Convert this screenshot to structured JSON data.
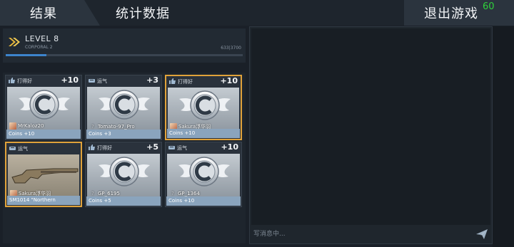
{
  "top_bar": {
    "tabs": [
      {
        "label": "结果",
        "active": true
      },
      {
        "label": "统计数据",
        "active": false
      }
    ],
    "exit_label": "退出游戏",
    "timer": "60"
  },
  "level": {
    "title": "LEVEL 8",
    "rank": "CORPORAL 2",
    "xp_text": "633|3700",
    "progress_fraction": 0.171
  },
  "rewards": [
    {
      "type_icon": "thumbs-up-icon",
      "type_label": "打得好",
      "amount": "+10",
      "player": "MrKaloz20",
      "avatar": "avatar-icon",
      "reward": "Coins +10",
      "highlight": false
    },
    {
      "type_icon": "luck-icon",
      "type_label": "运气",
      "amount": "+3",
      "player": "Tomato-97_Pro",
      "avatar": "unknown",
      "reward": "Coins +3",
      "highlight": false
    },
    {
      "type_icon": "thumbs-up-icon",
      "type_label": "打得好",
      "amount": "+10",
      "player": "Sakura浮华羽",
      "avatar": "avatar-icon",
      "reward": "Coins +10",
      "highlight": true
    },
    {
      "type_icon": "luck-icon",
      "type_label": "运气",
      "amount": "",
      "player": "Sakura浮华羽",
      "avatar": "avatar-icon",
      "reward": "SM1014 \"Northern",
      "highlight": true,
      "item": "shotgun"
    },
    {
      "type_icon": "thumbs-up-icon",
      "type_label": "打得好",
      "amount": "+5",
      "player": "GP_6195",
      "avatar": "unknown",
      "reward": "Coins +5",
      "highlight": false
    },
    {
      "type_icon": "luck-icon",
      "type_label": "运气",
      "amount": "+10",
      "player": "GP_1364",
      "avatar": "unknown",
      "reward": "Coins +10",
      "highlight": false
    }
  ],
  "chat": {
    "placeholder": "写消息中..."
  },
  "colors": {
    "highlight": "#e0a23a",
    "timer": "#2fd13b",
    "xp_fill": "#3d84cc"
  }
}
